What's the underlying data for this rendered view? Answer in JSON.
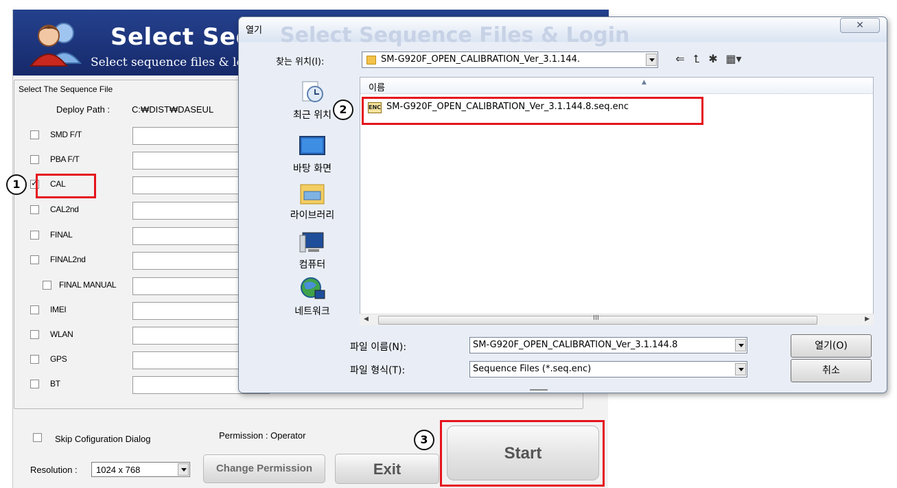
{
  "app": {
    "banner_title": "Select Sequence Files & Login",
    "banner_subtitle": "Select sequence files & login",
    "group_title": "Select The Sequence File",
    "deploy_label": "Deploy Path :",
    "deploy_path": "C:₩DIST₩DASEUL",
    "sequences": [
      {
        "label": "SMD F/T",
        "checked": false
      },
      {
        "label": "PBA F/T",
        "checked": false
      },
      {
        "label": "CAL",
        "checked": true
      },
      {
        "label": "CAL2nd",
        "checked": false
      },
      {
        "label": "FINAL",
        "checked": false
      },
      {
        "label": "FINAL2nd",
        "checked": false
      },
      {
        "label": "FINAL MANUAL",
        "checked": false
      },
      {
        "label": "IMEI",
        "checked": false
      },
      {
        "label": "WLAN",
        "checked": false
      },
      {
        "label": "GPS",
        "checked": false
      },
      {
        "label": "BT",
        "checked": false
      }
    ],
    "skip_config_label": "Skip Cofiguration Dialog",
    "permission_text": "Permission :  Operator",
    "resolution_label": "Resolution :",
    "resolution_value": "1024 x 768",
    "change_permission_label": "Change Permission",
    "exit_label": "Exit",
    "start_label": "Start"
  },
  "dialog": {
    "title": "열기",
    "close_glyph": "✕",
    "look_in_label": "찾는 위치(I):",
    "look_in_value": "SM-G920F_OPEN_CALIBRATION_Ver_3.1.144.",
    "places": [
      {
        "label": "최근 위치",
        "icon": "recent-places-icon"
      },
      {
        "label": "바탕 화면",
        "icon": "desktop-icon"
      },
      {
        "label": "라이브러리",
        "icon": "libraries-icon"
      },
      {
        "label": "컴퓨터",
        "icon": "computer-icon"
      },
      {
        "label": "네트워크",
        "icon": "network-icon"
      }
    ],
    "column_name": "이름",
    "file_icon_text": "ENC",
    "files": [
      {
        "name": "SM-G920F_OPEN_CALIBRATION_Ver_3.1.144.8.seq.enc"
      }
    ],
    "scroll_grip": "III",
    "file_name_label": "파일 이름(N):",
    "file_name_value": "SM-G920F_OPEN_CALIBRATION_Ver_3.1.144.8",
    "file_type_label": "파일 형식(T):",
    "file_type_value": "Sequence Files (*.seq.enc)",
    "open_label": "열기(O)",
    "cancel_label": "취소"
  },
  "callouts": [
    "1",
    "2",
    "3"
  ],
  "colors": {
    "highlight": "#e5121c",
    "banner": "#1c3379"
  }
}
